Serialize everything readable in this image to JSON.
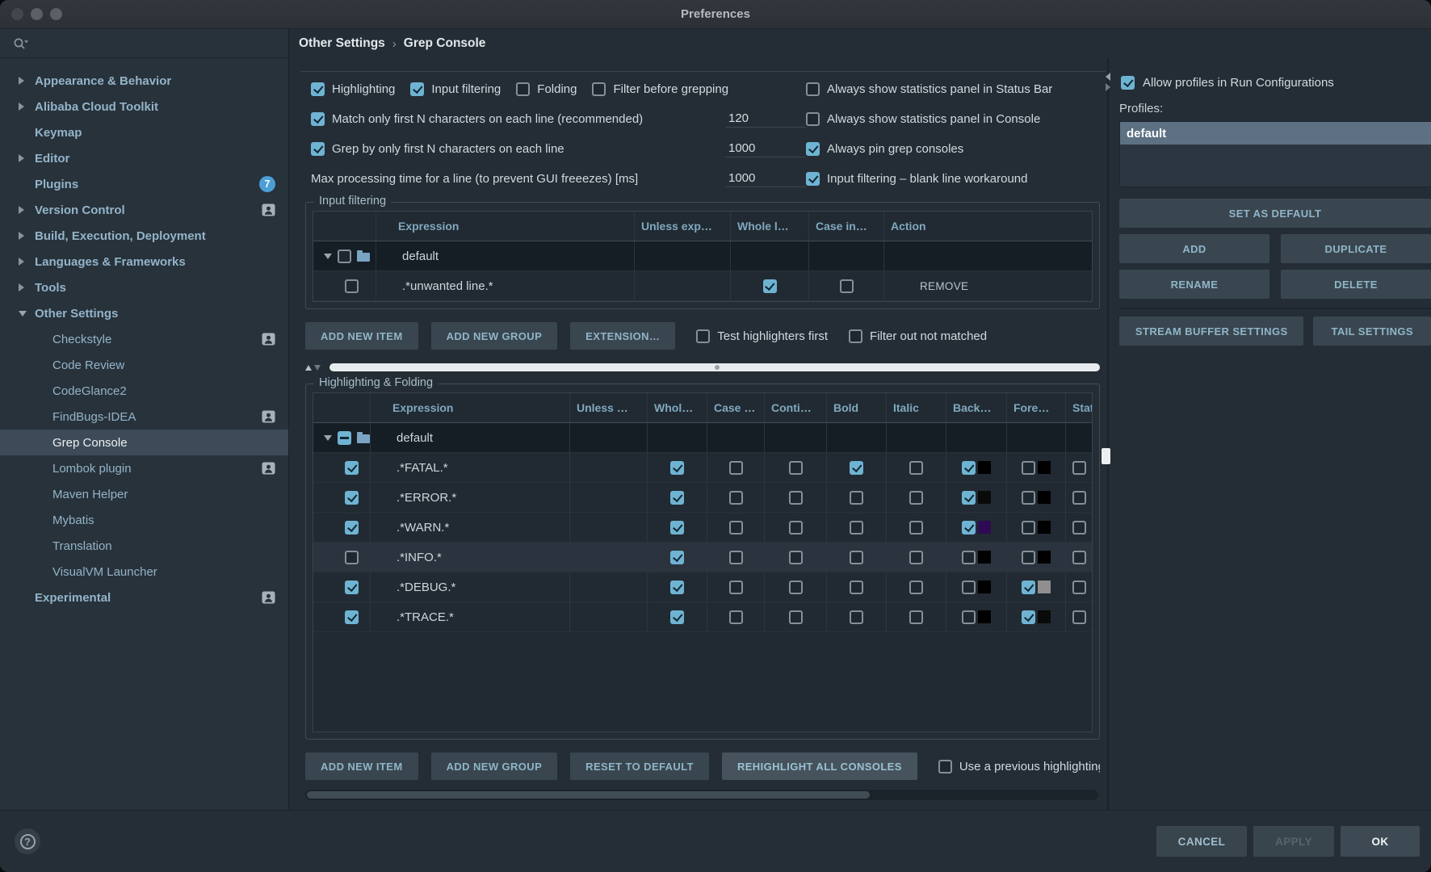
{
  "window": {
    "title": "Preferences"
  },
  "icons": {
    "traffic_lights": [
      "close",
      "minimize",
      "zoom"
    ],
    "sidebar_search": "search-icon",
    "tree_collapsed": "chevron-right-icon",
    "tree_expanded": "chevron-down-icon",
    "per_project": "person-icon",
    "group_folder": "folder-icon",
    "help_glyph": "?"
  },
  "sidebar": {
    "items": [
      {
        "label": "Appearance & Behavior",
        "arrow": "collapsed"
      },
      {
        "label": "Alibaba Cloud Toolkit",
        "arrow": "collapsed"
      },
      {
        "label": "Keymap"
      },
      {
        "label": "Editor",
        "arrow": "collapsed"
      },
      {
        "label": "Plugins",
        "badge": "7"
      },
      {
        "label": "Version Control",
        "arrow": "collapsed",
        "icon": "person"
      },
      {
        "label": "Build, Execution, Deployment",
        "arrow": "collapsed"
      },
      {
        "label": "Languages & Frameworks",
        "arrow": "collapsed"
      },
      {
        "label": "Tools",
        "arrow": "collapsed"
      },
      {
        "label": "Other Settings",
        "arrow": "expanded"
      },
      {
        "label": "Checkstyle",
        "child": true,
        "icon": "person"
      },
      {
        "label": "Code Review",
        "child": true
      },
      {
        "label": "CodeGlance2",
        "child": true
      },
      {
        "label": "FindBugs-IDEA",
        "child": true,
        "icon": "person"
      },
      {
        "label": "Grep Console",
        "child": true,
        "selected": true
      },
      {
        "label": "Lombok plugin",
        "child": true,
        "icon": "person"
      },
      {
        "label": "Maven Helper",
        "child": true
      },
      {
        "label": "Mybatis",
        "child": true
      },
      {
        "label": "Translation",
        "child": true
      },
      {
        "label": "VisualVM Launcher",
        "child": true
      },
      {
        "label": "Experimental",
        "icon": "person"
      }
    ]
  },
  "breadcrumb": {
    "section": "Other Settings",
    "separator": "›",
    "page": "Grep Console"
  },
  "general_options": {
    "inline": [
      {
        "label": "Highlighting",
        "checked": true
      },
      {
        "label": "Input filtering",
        "checked": true
      },
      {
        "label": "Folding",
        "checked": false
      },
      {
        "label": "Filter before grepping",
        "checked": false
      }
    ],
    "left_rows": [
      {
        "checkbox": true,
        "checked": true,
        "label": "Match only first N characters on each line (recommended)",
        "value": "120"
      },
      {
        "checkbox": true,
        "checked": true,
        "label": "Grep by only first N characters on each line",
        "value": "1000"
      },
      {
        "checkbox": false,
        "checked": false,
        "label": "Max processing time for a line (to prevent GUI freeezes) [ms]",
        "value": "1000"
      }
    ],
    "right_rows": [
      {
        "label": "Always show statistics panel in Status Bar",
        "checked": false
      },
      {
        "label": "Always show statistics panel in Console",
        "checked": false
      },
      {
        "label": "Always pin grep consoles",
        "checked": true
      },
      {
        "label": "Input filtering – blank line workaround",
        "checked": true
      }
    ]
  },
  "input_filtering": {
    "group_title": "Input filtering",
    "columns": [
      "",
      "Expression",
      "Unless exp…",
      "Whole l…",
      "Case in…",
      "Action"
    ],
    "group_row": {
      "label": "default",
      "checkbox": "unchecked",
      "expanded": true
    },
    "rows": [
      {
        "enabled": false,
        "expression": ".*unwanted line.*",
        "unless": "",
        "whole_line": true,
        "case_insensitive": false,
        "action": "REMOVE"
      }
    ],
    "buttons": [
      "ADD NEW ITEM",
      "ADD NEW GROUP",
      "EXTENSION…"
    ],
    "checkboxes": [
      {
        "label": "Test highlighters first",
        "checked": false
      },
      {
        "label": "Filter out not matched",
        "checked": false
      }
    ]
  },
  "highlighting": {
    "group_title": "Highlighting & Folding",
    "columns": [
      "",
      "Expression",
      "Unless …",
      "Whol…",
      "Case …",
      "Conti…",
      "Bold",
      "Italic",
      "Back…",
      "Fore…",
      "Status"
    ],
    "group_row": {
      "label": "default",
      "checkbox": "indeterminate",
      "expanded": true
    },
    "rows": [
      {
        "enabled": true,
        "expression": ".*FATAL.*",
        "whole": true,
        "case": false,
        "conti": false,
        "bold": true,
        "italic": false,
        "back": {
          "checked": true,
          "color": "#000000"
        },
        "fore": {
          "checked": false,
          "color": "#000000"
        },
        "status": false,
        "selected": false
      },
      {
        "enabled": true,
        "expression": ".*ERROR.*",
        "whole": true,
        "case": false,
        "conti": false,
        "bold": false,
        "italic": false,
        "back": {
          "checked": true,
          "color": "#0a0a0a"
        },
        "fore": {
          "checked": false,
          "color": "#000000"
        },
        "status": false,
        "selected": false
      },
      {
        "enabled": true,
        "expression": ".*WARN.*",
        "whole": true,
        "case": false,
        "conti": false,
        "bold": false,
        "italic": false,
        "back": {
          "checked": true,
          "color": "#2e0a52"
        },
        "fore": {
          "checked": false,
          "color": "#000000"
        },
        "status": false,
        "selected": false
      },
      {
        "enabled": false,
        "expression": ".*INFO.*",
        "whole": true,
        "case": false,
        "conti": false,
        "bold": false,
        "italic": false,
        "back": {
          "checked": false,
          "color": "#000000"
        },
        "fore": {
          "checked": false,
          "color": "#000000"
        },
        "status": false,
        "selected": true
      },
      {
        "enabled": true,
        "expression": ".*DEBUG.*",
        "whole": true,
        "case": false,
        "conti": false,
        "bold": false,
        "italic": false,
        "back": {
          "checked": false,
          "color": "#000000"
        },
        "fore": {
          "checked": true,
          "color": "#8f8f8f"
        },
        "status": false,
        "selected": false
      },
      {
        "enabled": true,
        "expression": ".*TRACE.*",
        "whole": true,
        "case": false,
        "conti": false,
        "bold": false,
        "italic": false,
        "back": {
          "checked": false,
          "color": "#000000"
        },
        "fore": {
          "checked": true,
          "color": "#0a0a0a"
        },
        "status": false,
        "selected": false
      }
    ],
    "buttons": [
      "ADD NEW ITEM",
      "ADD NEW GROUP",
      "RESET TO DEFAULT",
      "REHIGHLIGHT ALL CONSOLES"
    ],
    "checkbox": {
      "label": "Use a previous highlighting",
      "checked": false
    }
  },
  "profiles_panel": {
    "allow_label": "Allow profiles in Run Configurations",
    "allow_checked": true,
    "profiles_label": "Profiles:",
    "profiles": [
      {
        "name": "default",
        "selected": true
      }
    ],
    "full_button": "SET AS DEFAULT",
    "grid_buttons": [
      "ADD",
      "DUPLICATE",
      "RENAME",
      "DELETE"
    ],
    "bottom_buttons": [
      "STREAM BUFFER SETTINGS",
      "TAIL SETTINGS"
    ]
  },
  "footer": {
    "cancel": "CANCEL",
    "apply": "APPLY",
    "ok": "OK"
  },
  "colors": {
    "accent_checkbox": "#6fb3d3",
    "selection_sidebar": "#3d4b58",
    "selection_profile": "#5d7183",
    "swatch_black": "#000000",
    "swatch_purple": "#2e0a52",
    "swatch_gray": "#8f8f8f"
  }
}
